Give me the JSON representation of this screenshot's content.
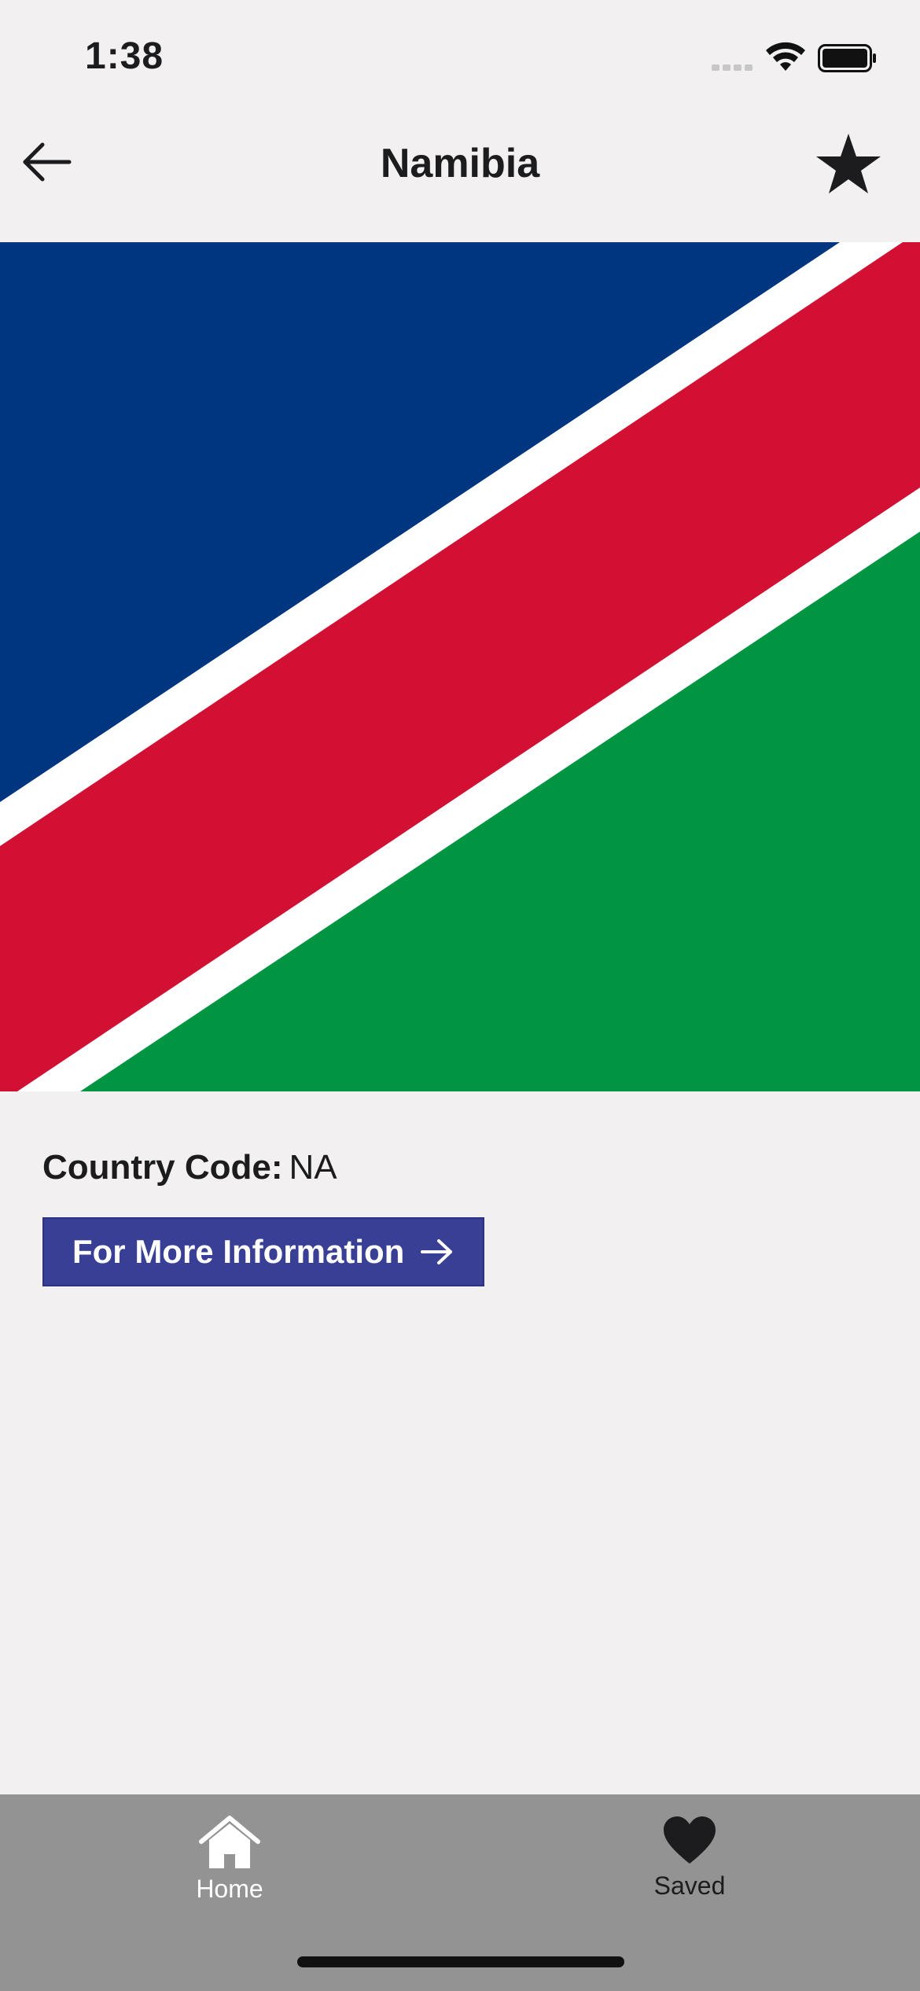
{
  "status_bar": {
    "time": "1:38",
    "icons": [
      "signal-icon",
      "wifi-icon",
      "battery-icon"
    ]
  },
  "nav": {
    "title": "Namibia",
    "back_icon": "arrow-left-icon",
    "favorite_icon": "star-icon"
  },
  "flag": {
    "country": "Namibia",
    "colors": {
      "blue": "#003580",
      "red": "#d21034",
      "green": "#009543",
      "white": "#ffffff"
    }
  },
  "details": {
    "country_code_label": "Country Code:",
    "country_code_value": "NA",
    "more_info_label": "For More Information",
    "more_info_icon": "arrow-right-icon"
  },
  "tabs": [
    {
      "label": "Home",
      "icon": "home-icon",
      "active": true
    },
    {
      "label": "Saved",
      "icon": "heart-icon",
      "active": false
    }
  ],
  "colors": {
    "background": "#f2f0f1",
    "button": "#393f95",
    "tab_bar": "#939393"
  }
}
